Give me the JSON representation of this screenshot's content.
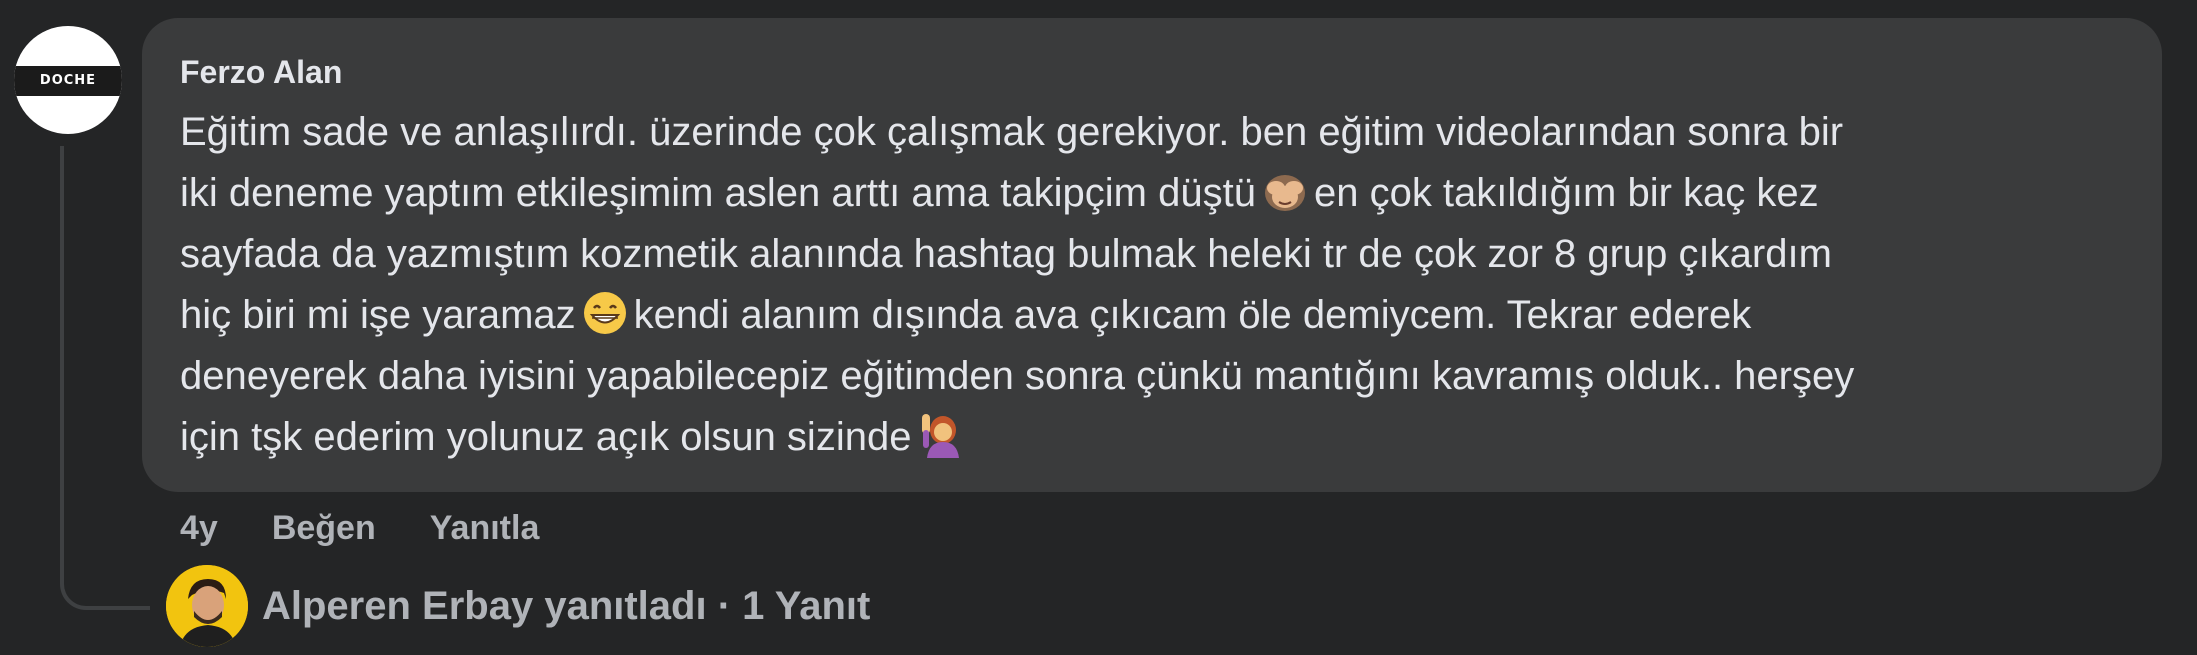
{
  "comment": {
    "author": "Ferzo Alan",
    "avatar_logo_text": "DOCHE",
    "lines": [
      "Eğitim sade ve anlaşılırdı. üzerinde çok çalışmak gerekiyor. ben eğitim videolarından sonra bir",
      "iki deneme yaptım etkileşimim aslen arttı ama takipçim düştü",
      "en çok takıldığım bir kaç kez",
      "sayfada da yazmıştım kozmetik alanında hashtag bulmak heleki tr de çok zor 8 grup çıkardım",
      "hiç biri mi işe yaramaz",
      "kendi alanım dışında ava çıkıcam öle demiycem. Tekrar ederek",
      "deneyerek daha iyisini yapabilecepiz eğitimden sonra çünkü mantığını kavramış olduk.. herşey",
      "için tşk ederim yolunuz açık olsun sizinde"
    ],
    "emojis": {
      "see_no_evil": "see-no-evil-monkey-icon",
      "grin": "grinning-face-icon",
      "raising_hand": "woman-raising-hand-icon"
    }
  },
  "actions": {
    "time": "4y",
    "like": "Beğen",
    "reply": "Yanıtla"
  },
  "reply_summary": {
    "text": "Alperen Erbay yanıtladı · 1 Yanıt"
  },
  "colors": {
    "background": "#242526",
    "bubble": "#3a3b3c",
    "primary_text": "#e4e6eb",
    "secondary_text": "#b0b3b8"
  }
}
